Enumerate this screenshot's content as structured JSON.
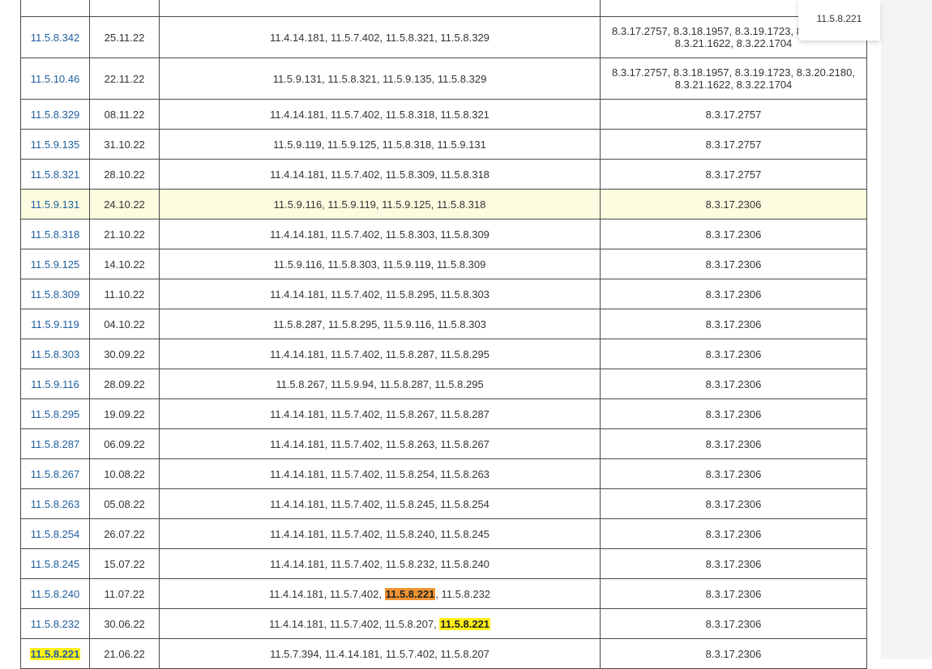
{
  "tooltip_text": "11.5.8.221",
  "rows": [
    {
      "version": "11.5.8.342",
      "date": "25.11.22",
      "updates_parts": [
        {
          "t": "11.4.14.181, 11.5.7.402, 11.5.8.321, 11.5.8.329"
        }
      ],
      "platform": "8.3.17.2757, 8.3.18.1957, 8.3.19.1723, 8.3.20.2180, 8.3.21.1622, 8.3.22.1704"
    },
    {
      "version": "11.5.10.46",
      "date": "22.11.22",
      "updates_parts": [
        {
          "t": "11.5.9.131, 11.5.8.321, 11.5.9.135, 11.5.8.329"
        }
      ],
      "platform": "8.3.17.2757, 8.3.18.1957, 8.3.19.1723, 8.3.20.2180, 8.3.21.1622, 8.3.22.1704"
    },
    {
      "version": "11.5.8.329",
      "date": "08.11.22",
      "updates_parts": [
        {
          "t": "11.4.14.181, 11.5.7.402, 11.5.8.318, 11.5.8.321"
        }
      ],
      "platform": "8.3.17.2757"
    },
    {
      "version": "11.5.9.135",
      "date": "31.10.22",
      "updates_parts": [
        {
          "t": "11.5.9.119, 11.5.9.125, 11.5.8.318, 11.5.9.131"
        }
      ],
      "platform": "8.3.17.2757"
    },
    {
      "version": "11.5.8.321",
      "date": "28.10.22",
      "updates_parts": [
        {
          "t": "11.4.14.181, 11.5.7.402, 11.5.8.309, 11.5.8.318"
        }
      ],
      "platform": "8.3.17.2757"
    },
    {
      "version": "11.5.9.131",
      "date": "24.10.22",
      "updates_parts": [
        {
          "t": "11.5.9.116, 11.5.9.119, 11.5.9.125, 11.5.8.318"
        }
      ],
      "platform": "8.3.17.2306",
      "hovered": true
    },
    {
      "version": "11.5.8.318",
      "date": "21.10.22",
      "updates_parts": [
        {
          "t": "11.4.14.181, 11.5.7.402, 11.5.8.303, 11.5.8.309"
        }
      ],
      "platform": "8.3.17.2306"
    },
    {
      "version": "11.5.9.125",
      "date": "14.10.22",
      "updates_parts": [
        {
          "t": "11.5.9.116, 11.5.8.303, 11.5.9.119, 11.5.8.309"
        }
      ],
      "platform": "8.3.17.2306"
    },
    {
      "version": "11.5.8.309",
      "date": "11.10.22",
      "updates_parts": [
        {
          "t": "11.4.14.181, 11.5.7.402, 11.5.8.295, 11.5.8.303"
        }
      ],
      "platform": "8.3.17.2306"
    },
    {
      "version": "11.5.9.119",
      "date": "04.10.22",
      "updates_parts": [
        {
          "t": "11.5.8.287, 11.5.8.295, 11.5.9.116, 11.5.8.303"
        }
      ],
      "platform": "8.3.17.2306"
    },
    {
      "version": "11.5.8.303",
      "date": "30.09.22",
      "updates_parts": [
        {
          "t": "11.4.14.181, 11.5.7.402, 11.5.8.287, 11.5.8.295"
        }
      ],
      "platform": "8.3.17.2306"
    },
    {
      "version": "11.5.9.116",
      "date": "28.09.22",
      "updates_parts": [
        {
          "t": "11.5.8.267, 11.5.9.94, 11.5.8.287, 11.5.8.295"
        }
      ],
      "platform": "8.3.17.2306"
    },
    {
      "version": "11.5.8.295",
      "date": "19.09.22",
      "updates_parts": [
        {
          "t": "11.4.14.181, 11.5.7.402, 11.5.8.267, 11.5.8.287"
        }
      ],
      "platform": "8.3.17.2306"
    },
    {
      "version": "11.5.8.287",
      "date": "06.09.22",
      "updates_parts": [
        {
          "t": "11.4.14.181, 11.5.7.402, 11.5.8.263, 11.5.8.267"
        }
      ],
      "platform": "8.3.17.2306"
    },
    {
      "version": "11.5.8.267",
      "date": "10.08.22",
      "updates_parts": [
        {
          "t": "11.4.14.181, 11.5.7.402, 11.5.8.254, 11.5.8.263"
        }
      ],
      "platform": "8.3.17.2306"
    },
    {
      "version": "11.5.8.263",
      "date": "05.08.22",
      "updates_parts": [
        {
          "t": "11.4.14.181, 11.5.7.402, 11.5.8.245, 11.5.8.254"
        }
      ],
      "platform": "8.3.17.2306"
    },
    {
      "version": "11.5.8.254",
      "date": "26.07.22",
      "updates_parts": [
        {
          "t": "11.4.14.181, 11.5.7.402, 11.5.8.240, 11.5.8.245"
        }
      ],
      "platform": "8.3.17.2306"
    },
    {
      "version": "11.5.8.245",
      "date": "15.07.22",
      "updates_parts": [
        {
          "t": "11.4.14.181, 11.5.7.402, 11.5.8.232, 11.5.8.240"
        }
      ],
      "platform": "8.3.17.2306"
    },
    {
      "version": "11.5.8.240",
      "date": "11.07.22",
      "updates_parts": [
        {
          "t": "11.4.14.181, 11.5.7.402, "
        },
        {
          "t": "11.5.8.221",
          "mark": "orange"
        },
        {
          "t": ", 11.5.8.232"
        }
      ],
      "platform": "8.3.17.2306"
    },
    {
      "version": "11.5.8.232",
      "date": "30.06.22",
      "updates_parts": [
        {
          "t": "11.4.14.181, 11.5.7.402, 11.5.8.207, "
        },
        {
          "t": "11.5.8.221",
          "mark": "yellow"
        }
      ],
      "platform": "8.3.17.2306"
    },
    {
      "version": "11.5.8.221",
      "version_mark": "yellow",
      "date": "21.06.22",
      "updates_parts": [
        {
          "t": "11.5.7.394, 11.4.14.181, 11.5.7.402, 11.5.8.207"
        }
      ],
      "platform": "8.3.17.2306"
    }
  ]
}
